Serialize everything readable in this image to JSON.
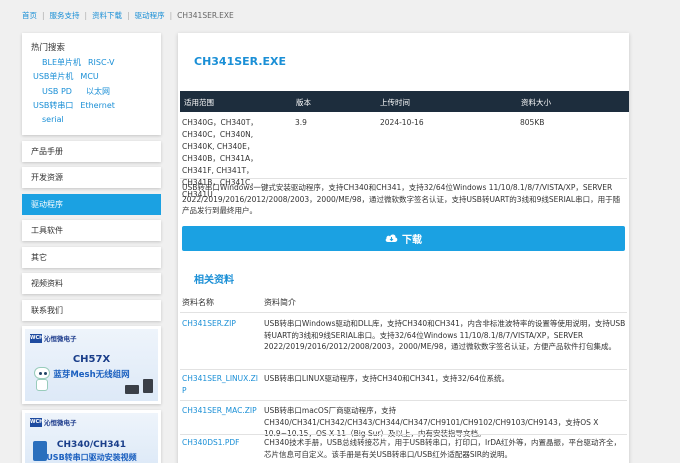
{
  "breadcrumb": {
    "home": "首页",
    "support": "服务支持",
    "download": "资料下载",
    "driver": "驱动程序",
    "current": "CH341SER.EXE"
  },
  "hot_search": {
    "title": "热门搜索",
    "links": [
      "BLE单片机",
      "RISC-V",
      "USB单片机",
      "MCU",
      "USB PD",
      "以太网",
      "USB转串口",
      "Ethernet",
      "serial"
    ]
  },
  "nav": {
    "items": [
      "产品手册",
      "开发资源",
      "驱动程序",
      "工具软件",
      "其它",
      "视频资料",
      "联系我们"
    ],
    "active_index": 2
  },
  "promos": [
    {
      "brand": "沁恒微电子",
      "logo": "WCH",
      "title": "CH57X",
      "subtitle": "蓝芽Mesh无线组网"
    },
    {
      "brand": "沁恒微电子",
      "logo": "WCH",
      "title": "CH340/CH341",
      "subtitle": "USB转串口驱动安装视频"
    }
  ],
  "file": {
    "title": "CH341SER.EXE",
    "headers": {
      "scope": "适用范围",
      "version": "版本",
      "date": "上传时间",
      "size": "资料大小"
    },
    "scope": "CH340G，CH340T，CH340C，CH340N, CH340K, CH340E，CH340B，CH341A，CH341F, CH341T，CH341B，CH341C，CH341U",
    "version": "3.9",
    "date": "2024-10-16",
    "size": "805KB",
    "description": "USB转串口Windows一键式安装驱动程序，支持CH340和CH341，支持32/64位Windows 11/10/8.1/8/7/VISTA/XP，SERVER 2022/2019/2016/2012/2008/2003，2000/ME/98，通过微软数字签名认证，支持USB转UART的3线和9线SERIAL串口，用于随产品发行到最终用户。",
    "download_label": "下载"
  },
  "related": {
    "title": "相关资料",
    "col_name": "资料名称",
    "col_desc": "资料简介",
    "rows": [
      {
        "name": "CH341SER.ZIP",
        "desc": "USB转串口Windows驱动和DLL库，支持CH340和CH341，内含非标准波特率的设置等使用说明，支持USB转UART的3线和9线SERIAL串口。支持32/64位Windows 11/10/8.1/8/7/VISTA/XP，SERVER 2022/2019/2016/2012/2008/2003，2000/ME/98，通过微软数字签名认证，方便产品软件打包集成。"
      },
      {
        "name": "CH341SER_LINUX.ZIP",
        "desc": "USB转串口LINUX驱动程序，支持CH340和CH341，支持32/64位系统。"
      },
      {
        "name": "CH341SER_MAC.ZIP",
        "desc": "USB转串口macOS厂商驱动程序，支持CH340/CH341/CH342/CH343/CH344/CH347/CH9101/CH9102/CH9103/CH9143，支持OS X 10.9~10.15，OS X 11（Big Sur）及以上，内有安装指导文档。"
      },
      {
        "name": "CH340DS1.PDF",
        "desc": "CH340技术手册，USB总线转接芯片，用于USB转串口，打印口，IrDA红外等，内置晶振，平台驱动齐全，芯片信息可自定义。该手册是有关USB转串口/USB红外适配器SIR的说明。"
      }
    ]
  },
  "colors": {
    "accent": "#1ba1e2",
    "link": "#1a8fd6",
    "table_header": "#1d2d3d"
  }
}
